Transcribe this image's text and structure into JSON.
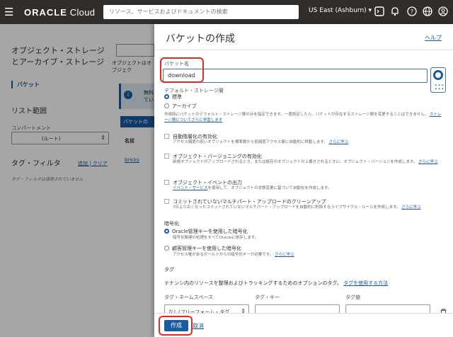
{
  "topbar": {
    "brand_strong": "ORACLE",
    "brand_rest": " Cloud",
    "search_placeholder": "リソース、サービスおよびドキュメントの検索",
    "region": "US East (Ashburn) ▾",
    "icons": [
      "menu-icon",
      "terminal-icon",
      "bell-icon",
      "help-icon",
      "globe-icon",
      "user-icon"
    ]
  },
  "background": {
    "left_title": "オブジェクト・ストレージとアーカイブ・ストレージ",
    "nav_bucket": "バケット",
    "list_scope": "リスト範囲",
    "compartment_label": "コンパートメント",
    "compartment_value": "(ルート)",
    "tag_filter": "タグ・フィルタ",
    "tag_add": "追加 | クリア",
    "tag_note": "タグ・フィルタは適用されていません",
    "note": "オブジェクトはオブジェク",
    "info_text": "無料\nてい",
    "create_btn": "バケットの",
    "th_name": "名前",
    "row_name": "bricks"
  },
  "panel": {
    "title": "バケットの作成",
    "help": "ヘルプ",
    "bucket_name_label": "バケット名",
    "bucket_name_value": "download",
    "storage_tier_label": "デフォルト・ストレージ層",
    "tier_standard": "標準",
    "tier_archive": "アーカイブ",
    "tier_note": "作成時にバケットのデフォルト・ストレージ層のみを指定できます。一度設定したら、バケットが存在するストレージ層を変更することはできません。",
    "tier_note_link": "ストレージ層についてさらに学習します",
    "auto_tiering": "自動階層化の有効化",
    "auto_tiering_desc": "アクセス頻度の低いオブジェクトを標準層から低頻度アクセス層に自動的に移動します。",
    "auto_tiering_link": "さらに学ぶ",
    "versioning": "オブジェクト・バージョニングの有効化",
    "versioning_desc": "新規オブジェクトがアップロードされるとき、または既存のオブジェクトが上書きされるときに、オブジェクト・バージョンを作成します。",
    "versioning_link": "さらに学ぶ",
    "events": "オブジェクト・イベントの出力",
    "events_desc_link": "イベント・サービス",
    "events_desc": "を使用して、オブジェクトの状態変更に基づいて自動化を作成します。",
    "cleanup": "コミットされていないマルチパート・アップロードのクリーンアップ",
    "cleanup_desc": "7日より古くなったコミットされていないマルチパート・アップロードを自動的に削除するライフサイクル・ルールを作成します。",
    "cleanup_link": "さらに学ぶ",
    "encryption_label": "暗号化",
    "enc_oracle": "Oracle管理キーを使用した暗号化",
    "enc_oracle_desc": "暗号化関連の処理をすべてOracleに依存します。",
    "enc_customer": "顧客管理キーを使用した暗号化",
    "enc_customer_desc": "アクセス権があるボールトからの暗号化キーが必要です。",
    "enc_customer_link": "さらに学ぶ",
    "tags_label": "タグ",
    "tags_desc": "テナンシ内のリソースを整理およびトラッキングするためのオプションのタグ。",
    "tags_link": "タグを使用する方法",
    "col_namespace": "タグ・ネームスペース",
    "col_key": "タグ・キー",
    "col_value": "タグ値",
    "namespace_value": "なし(フリーフォーム・タグ..."
  },
  "footer": {
    "create": "作成",
    "cancel": "取消"
  }
}
